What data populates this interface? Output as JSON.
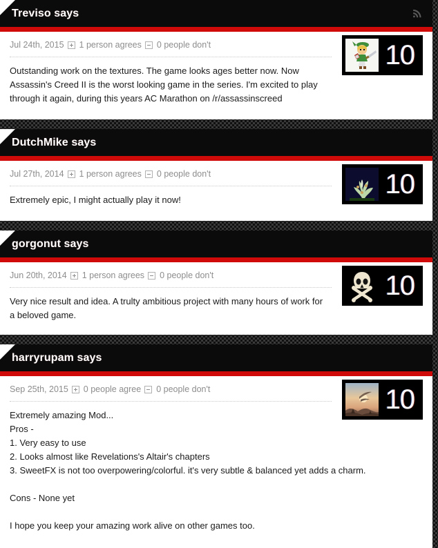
{
  "page": {
    "accent_color": "#cf0a09",
    "header_bg": "#0b0b0b",
    "panel_bg": "#ffffff",
    "meta_text_color": "#8d8d8d",
    "body_text_color": "#1a1a1a",
    "score_badge_bg": "#000000"
  },
  "reviews": [
    {
      "author": "Treviso says",
      "date": "Jul 24th, 2015",
      "agrees": "1 person agrees",
      "disagrees": "0 people don't",
      "agree_icon": "plus-box-icon",
      "disagree_icon": "minus-box-icon",
      "score": "10",
      "avatar_icon": "avatar-link-swordsman",
      "text": "Outstanding work on the textures. The game looks ages better now. Now Assassin's Creed II is the worst looking game in the series. I'm excited to play through it again, during this years AC Marathon on /r/assassinscreed",
      "has_feed_icon": true,
      "feed_icon": "rss-feed-icon"
    },
    {
      "author": "DutchMike says",
      "date": "Jul 27th, 2014",
      "agrees": "1 person agrees",
      "disagrees": "0 people don't",
      "agree_icon": "plus-box-icon",
      "disagree_icon": "minus-box-icon",
      "score": "10",
      "avatar_icon": "avatar-plant-bloom",
      "text": "Extremely epic, I might actually play it now!",
      "has_feed_icon": false,
      "feed_icon": ""
    },
    {
      "author": "gorgonut says",
      "date": "Jun 20th, 2014",
      "agrees": "1 person agrees",
      "disagrees": "0 people don't",
      "agree_icon": "plus-box-icon",
      "disagree_icon": "minus-box-icon",
      "score": "10",
      "avatar_icon": "avatar-skull-crossbones",
      "text": "Very nice result and idea. A trulty ambitious project with many hours of work for a beloved game.",
      "has_feed_icon": false,
      "feed_icon": ""
    },
    {
      "author": "harryrupam says",
      "date": "Sep 25th, 2015",
      "agrees": "0 people agree",
      "disagrees": "0 people don't",
      "agree_icon": "plus-box-icon",
      "disagree_icon": "minus-box-icon",
      "score": "10",
      "avatar_icon": "avatar-sunset-landscape",
      "text": "Extremely amazing Mod...\nPros -\n1. Very easy to use\n2. Looks almost like Revelations's Altair's chapters\n3. SweetFX is not too overpowering/colorful. it's very subtle & balanced yet adds a charm.\n\nCons - None yet\n\nI hope you keep your amazing work alive on other games too.",
      "has_feed_icon": false,
      "feed_icon": ""
    }
  ]
}
